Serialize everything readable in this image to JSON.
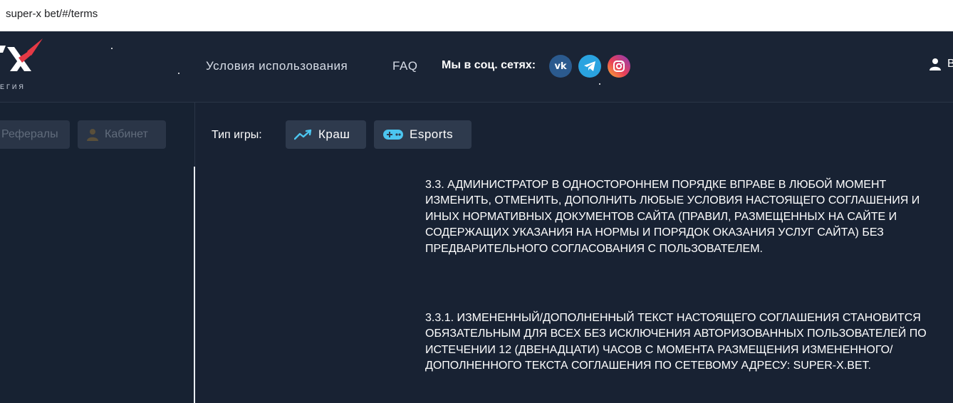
{
  "browser": {
    "url": "super-x bet/#/terms"
  },
  "header": {
    "logo_subtitle": "ЕГИЯ",
    "nav": [
      {
        "label": "Условия использования"
      },
      {
        "label": "FAQ"
      }
    ],
    "social_label": "Мы в соц. сетях:",
    "social_icons": [
      {
        "name": "vk-icon",
        "text": "vk",
        "color": "#2b5a8e"
      },
      {
        "name": "telegram-icon",
        "color": "#2aa3e0"
      },
      {
        "name": "instagram-icon",
        "color": "#e94057"
      }
    ],
    "user_label": "В"
  },
  "sidebar": {
    "referrals_label": "Рефералы",
    "cabinet_label": "Кабинет"
  },
  "game_type": {
    "label": "Тип игры:",
    "options": [
      {
        "label": "Краш",
        "icon": "trend-icon"
      },
      {
        "label": "Esports",
        "icon": "gamepad-icon"
      }
    ]
  },
  "terms": {
    "paragraphs": [
      "3.3. АДМИНИСТРАТОР В ОДНОСТОРОННЕМ ПОРЯДКЕ ВПРАВЕ В ЛЮБОЙ МОМЕНТ ИЗМЕНИТЬ, ОТМЕНИТЬ, ДОПОЛНИТЬ ЛЮБЫЕ УСЛОВИЯ НАСТОЯЩЕГО СОГЛАШЕНИЯ И ИНЫХ НОРМАТИВНЫХ ДОКУМЕНТОВ САЙТА (ПРАВИЛ, РАЗМЕЩЕННЫХ НА САЙТЕ И СОДЕРЖАЩИХ УКАЗАНИЯ НА НОРМЫ И ПОРЯДОК ОКАЗАНИЯ УСЛУГ САЙТА) БЕЗ ПРЕДВАРИТЕЛЬНОГО СОГЛАСОВАНИЯ С ПОЛЬЗОВАТЕЛЕМ.",
      "3.3.1. ИЗМЕНЕННЫЙ/ДОПОЛНЕННЫЙ ТЕКСТ НАСТОЯЩЕГО СОГЛАШЕНИЯ СТАНОВИТСЯ ОБЯЗАТЕЛЬНЫМ ДЛЯ ВСЕХ БЕЗ ИСКЛЮЧЕНИЯ АВТОРИЗОВАННЫХ ПОЛЬЗОВАТЕЛЕЙ ПО ИСТЕЧЕНИИ 12 (ДВЕНАДЦАТИ) ЧАСОВ С МОМЕНТА РАЗМЕЩЕНИЯ ИЗМЕНЕННОГО/ДОПОЛНЕННОГО ТЕКСТА СОГЛАШЕНИЯ ПО СЕТЕВОМУ АДРЕСУ: SUPER-X.BET."
    ]
  },
  "colors": {
    "background": "#182233",
    "header_bg": "#1a2435",
    "button_bg": "#2e3a4d",
    "accent_red": "#e53945",
    "accent_cyan": "#4cc6f0"
  }
}
